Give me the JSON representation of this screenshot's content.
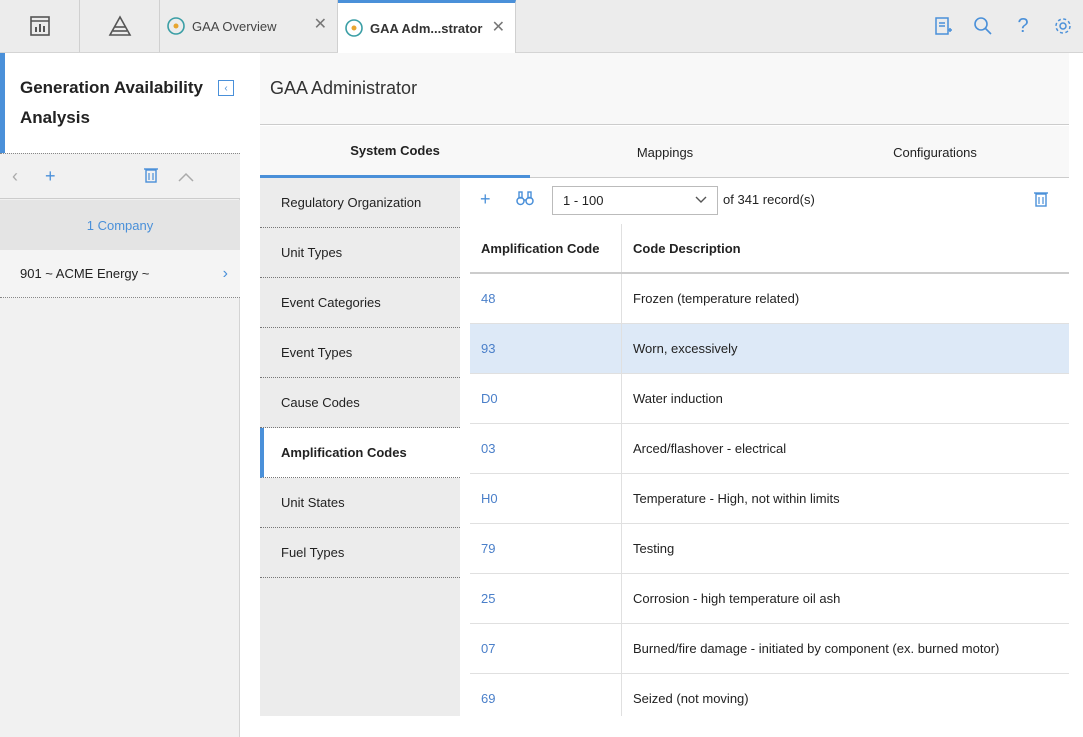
{
  "tabs": [
    {
      "label": "GAA Overview"
    },
    {
      "label": "GAA Adm...strator"
    }
  ],
  "left_panel": {
    "title": "Generation Availability Analysis",
    "company_header": "1 Company",
    "company_row": "901 ~ ACME Energy ~"
  },
  "main": {
    "title": "GAA Administrator",
    "subtabs": [
      "System Codes",
      "Mappings",
      "Configurations"
    ],
    "code_list": [
      "Regulatory Organization",
      "Unit Types",
      "Event Categories",
      "Event Types",
      "Cause Codes",
      "Amplification Codes",
      "Unit States",
      "Fuel Types"
    ],
    "active_code": "Amplification Codes",
    "pager": {
      "range": "1 - 100",
      "of_label": "of",
      "total": "341",
      "records_label": "record(s)"
    },
    "grid": {
      "columns": [
        "Amplification Code",
        "Code Description"
      ],
      "rows": [
        {
          "code": "48",
          "desc": "Frozen (temperature related)"
        },
        {
          "code": "93",
          "desc": "Worn, excessively"
        },
        {
          "code": "D0",
          "desc": "Water induction"
        },
        {
          "code": "03",
          "desc": "Arced/flashover - electrical"
        },
        {
          "code": "H0",
          "desc": "Temperature - High, not within limits"
        },
        {
          "code": "79",
          "desc": "Testing"
        },
        {
          "code": "25",
          "desc": "Corrosion - high temperature oil ash"
        },
        {
          "code": "07",
          "desc": "Burned/fire damage - initiated by component (ex. burned motor)"
        },
        {
          "code": "69",
          "desc": "Seized (not moving)"
        }
      ]
    }
  },
  "colors": {
    "accent": "#4a90d9",
    "selected_row": "#dde9f7"
  }
}
